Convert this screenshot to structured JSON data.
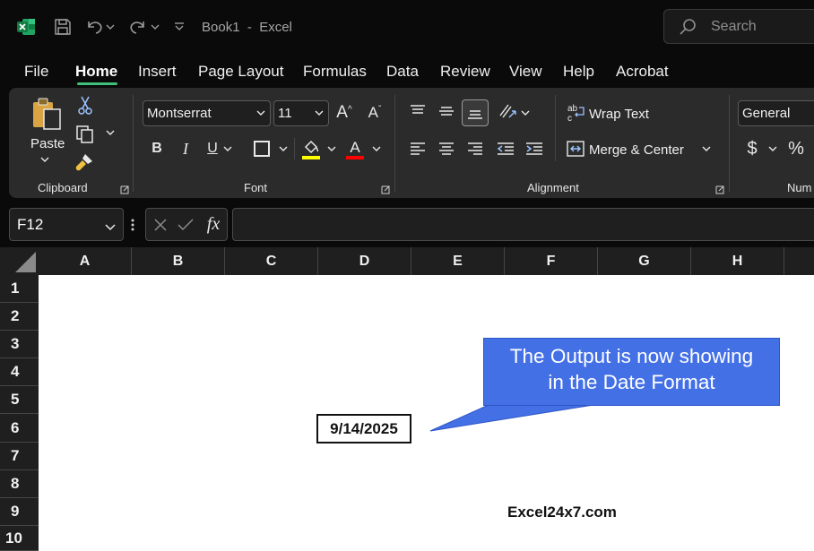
{
  "app": {
    "title": "Book1  -  Excel",
    "brand_color": "#21a366"
  },
  "search": {
    "placeholder": "Search"
  },
  "menu": {
    "tabs": [
      {
        "label": "File"
      },
      {
        "label": "Home",
        "active": true
      },
      {
        "label": "Insert"
      },
      {
        "label": "Page Layout"
      },
      {
        "label": "Formulas"
      },
      {
        "label": "Data"
      },
      {
        "label": "Review"
      },
      {
        "label": "View"
      },
      {
        "label": "Help"
      },
      {
        "label": "Acrobat"
      }
    ],
    "active_color": "#3fbf7a"
  },
  "ribbon": {
    "clipboard": {
      "group_label": "Clipboard",
      "paste_label": "Paste"
    },
    "font": {
      "group_label": "Font",
      "font_name": "Montserrat",
      "font_size": "11",
      "highlight_color": "#ffff00",
      "font_color": "#ff0000"
    },
    "alignment": {
      "group_label": "Alignment",
      "wrap_text_label": "Wrap Text",
      "merge_center_label": "Merge & Center"
    },
    "number": {
      "group_label": "Num",
      "format": "General",
      "currency_symbol": "$",
      "percent_symbol": "%"
    }
  },
  "formula_bar": {
    "name_box": "F12",
    "fx_label": "fx",
    "formula": ""
  },
  "grid": {
    "columns": [
      "A",
      "B",
      "C",
      "D",
      "E",
      "F",
      "G",
      "H"
    ],
    "rows": [
      "1",
      "2",
      "3",
      "4",
      "5",
      "6",
      "7",
      "8",
      "9",
      "10"
    ]
  },
  "content": {
    "date_value": "9/14/2025",
    "callout_line1": "The Output is now showing",
    "callout_line2": "in the Date Format",
    "callout_color": "#4470e6",
    "watermark": "Excel24x7.com"
  }
}
